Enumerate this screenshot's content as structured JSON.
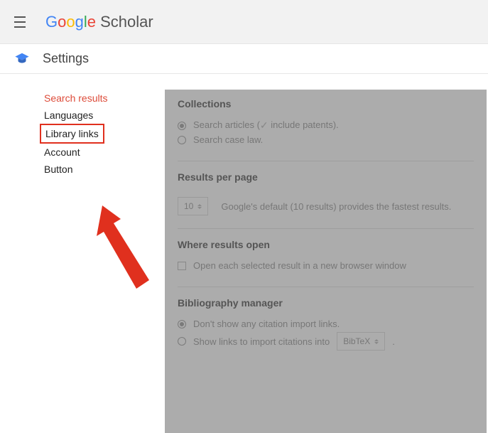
{
  "header": {
    "logo_text": "Google",
    "logo_suffix": " Scholar"
  },
  "title": "Settings",
  "sidebar": {
    "items": [
      {
        "label": "Search results"
      },
      {
        "label": "Languages"
      },
      {
        "label": "Library links"
      },
      {
        "label": "Account"
      },
      {
        "label": "Button"
      }
    ]
  },
  "main": {
    "collections": {
      "title": "Collections",
      "opt_articles_prefix": "Search articles (",
      "opt_articles_suffix": " include patents).",
      "opt_caselaw": "Search case law."
    },
    "perpage": {
      "title": "Results per page",
      "value": "10",
      "hint": "Google's default (10 results) provides the fastest results."
    },
    "openwhere": {
      "title": "Where results open",
      "label": "Open each selected result in a new browser window"
    },
    "bib": {
      "title": "Bibliography manager",
      "opt_none": "Don't show any citation import links.",
      "opt_import": "Show links to import citations into",
      "format_value": "BibTeX",
      "period": "."
    }
  }
}
